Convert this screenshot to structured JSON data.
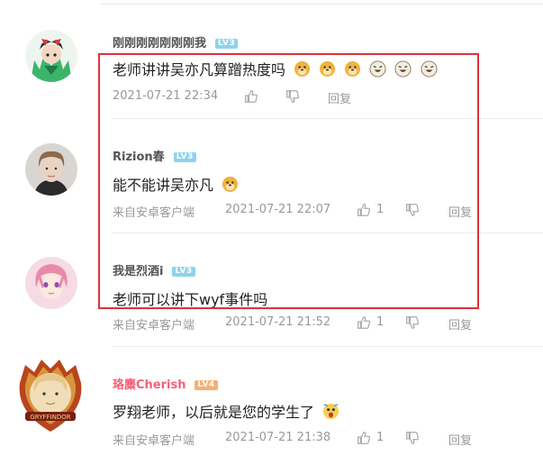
{
  "comments": [
    {
      "username": "刚刚刚刚刚刚刚我",
      "level": "LV3",
      "text": "老师讲讲吴亦凡算蹭热度吗",
      "source": "",
      "time": "2021-07-21 22:34",
      "likes": "",
      "reply": "回复"
    },
    {
      "username": "Rizion春",
      "level": "LV3",
      "text": "能不能讲吴亦凡",
      "source": "来自安卓客户端",
      "time": "2021-07-21 22:07",
      "likes": "1",
      "reply": "回复"
    },
    {
      "username": "我是烈酒i",
      "level": "LV3",
      "text": "老师可以讲下wyf事件吗",
      "source": "来自安卓客户端",
      "time": "2021-07-21 21:52",
      "likes": "1",
      "reply": "回复"
    },
    {
      "username": "珞麋Cherish",
      "level": "LV4",
      "text": "罗翔老师，以后就是您的学生了",
      "source": "来自安卓客户端",
      "time": "2021-07-21 21:38",
      "likes": "1",
      "reply": "回复"
    }
  ],
  "colors": {
    "highlight_box": "#e0303b",
    "level_badge": "#8fd3ea",
    "level_badge_lv4": "#f6b06f",
    "vip_name": "#f2607a"
  },
  "icons": [
    "like-icon",
    "dislike-icon",
    "doge-emoji",
    "laughing-emoji",
    "shocked-emoji"
  ]
}
